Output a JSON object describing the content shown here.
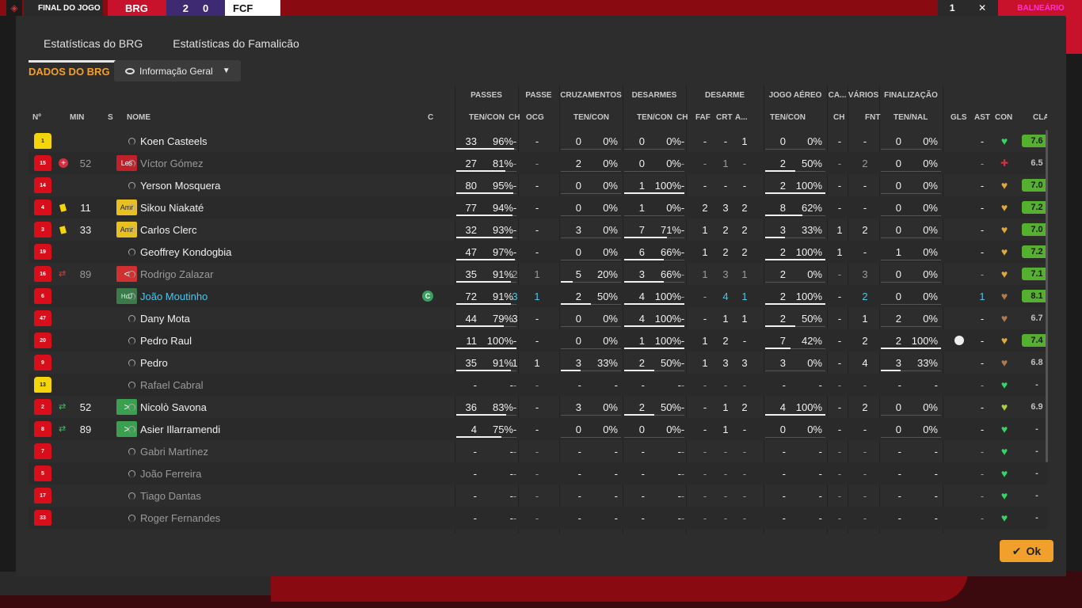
{
  "scorebar": {
    "final_label": "FINAL DO JOGO",
    "team1": "BRG",
    "score1": "2",
    "score2": "0",
    "team2": "FCF",
    "ctrl": "1",
    "balneario": "BALNEÁRIO"
  },
  "tabs": [
    {
      "label": "Estatísticas do BRG",
      "active": true
    },
    {
      "label": "Estatísticas do Famalicão",
      "active": false
    }
  ],
  "section_title": "DADOS DO BRG",
  "view_dropdown": "Informação Geral",
  "groups": {
    "passes": "PASSES",
    "passe": "PASSE",
    "cruzamentos": "CRUZAMENTOS",
    "desarmes": "DESARMES",
    "desarme": "DESARME",
    "jogo_aereo": "JOGO AÉREO",
    "ca": "CA...",
    "varios": "VÁRIOS",
    "finalizacao": "FINALIZAÇÃO"
  },
  "headers": {
    "num": "Nº",
    "min": "MIN",
    "s": "S",
    "nome": "NOME",
    "c": "C",
    "passes": "TEN/CON",
    "passe_ch": "CH",
    "passe_ocg": "OCG",
    "cruz": "TEN/CON",
    "desarmes": "TEN/CON",
    "des_ch": "CH",
    "des_faf": "FAF",
    "des_crt": "CRT",
    "des_a": "A...",
    "aereo": "TEN/CON",
    "ca_ch": "CH",
    "fnt": "FNT",
    "fin": "TEN/NAL",
    "gls": "GLS",
    "ast": "AST",
    "con": "CON",
    "cla": "CLA"
  },
  "rows": [
    {
      "n": "1",
      "gk": true,
      "min": "",
      "ic": "",
      "st": "",
      "stc": "",
      "name": "Koen Casteels",
      "hl": false,
      "dim": false,
      "pass": [
        "33",
        "96%"
      ],
      "pw": 0.96,
      "pch": "-",
      "pocg": "-",
      "cr": [
        "0",
        "0%"
      ],
      "cw": 0,
      "de": [
        "0",
        "0%"
      ],
      "dw": 0,
      "dch": "-",
      "faf": "-",
      "crt": "-",
      "da": "1",
      "ae": [
        "0",
        "0%"
      ],
      "aw": 0,
      "cach": "-",
      "fnt": "-",
      "fi": [
        "0",
        "0%"
      ],
      "fw": 0,
      "gls": "",
      "ast": "-",
      "con": "g",
      "cla": "7.6",
      "clag": true
    },
    {
      "n": "15",
      "gk": false,
      "min": "52",
      "ic": "inj",
      "st": "Les",
      "stc": "les",
      "name": "Víctor Gómez",
      "hl": false,
      "dim": true,
      "pass": [
        "27",
        "81%"
      ],
      "pw": 0.81,
      "pch": "-",
      "pocg": "-",
      "cr": [
        "2",
        "0%"
      ],
      "cw": 0,
      "de": [
        "0",
        "0%"
      ],
      "dw": 0,
      "dch": "-",
      "faf": "-",
      "crt": "1",
      "da": "-",
      "ae": [
        "2",
        "50%"
      ],
      "aw": 0.5,
      "cach": "-",
      "fnt": "2",
      "fi": [
        "0",
        "0%"
      ],
      "fw": 0,
      "gls": "",
      "ast": "-",
      "con": "x",
      "cla": "6.5",
      "clag": false
    },
    {
      "n": "14",
      "gk": false,
      "min": "",
      "ic": "",
      "st": "",
      "stc": "",
      "name": "Yerson Mosquera",
      "hl": false,
      "dim": false,
      "pass": [
        "80",
        "95%"
      ],
      "pw": 0.95,
      "pch": "-",
      "pocg": "-",
      "cr": [
        "0",
        "0%"
      ],
      "cw": 0,
      "de": [
        "1",
        "100%"
      ],
      "dw": 1,
      "dch": "-",
      "faf": "-",
      "crt": "-",
      "da": "-",
      "ae": [
        "2",
        "100%"
      ],
      "aw": 1,
      "cach": "-",
      "fnt": "-",
      "fi": [
        "0",
        "0%"
      ],
      "fw": 0,
      "gls": "",
      "ast": "-",
      "con": "o",
      "cla": "7.0",
      "clag": true
    },
    {
      "n": "4",
      "gk": false,
      "min": "11",
      "ic": "yc",
      "st": "Amr",
      "stc": "amr",
      "name": "Sikou Niakaté",
      "hl": false,
      "dim": false,
      "pass": [
        "77",
        "94%"
      ],
      "pw": 0.94,
      "pch": "-",
      "pocg": "-",
      "cr": [
        "0",
        "0%"
      ],
      "cw": 0,
      "de": [
        "1",
        "0%"
      ],
      "dw": 0,
      "dch": "-",
      "faf": "2",
      "crt": "3",
      "da": "2",
      "ae": [
        "8",
        "62%"
      ],
      "aw": 0.62,
      "cach": "-",
      "fnt": "-",
      "fi": [
        "0",
        "0%"
      ],
      "fw": 0,
      "gls": "",
      "ast": "-",
      "con": "o",
      "cla": "7.2",
      "clag": true
    },
    {
      "n": "3",
      "gk": false,
      "min": "33",
      "ic": "yc",
      "st": "Amr",
      "stc": "amr",
      "name": "Carlos Clerc",
      "hl": false,
      "dim": false,
      "pass": [
        "32",
        "93%"
      ],
      "pw": 0.93,
      "pch": "-",
      "pocg": "-",
      "cr": [
        "3",
        "0%"
      ],
      "cw": 0,
      "de": [
        "7",
        "71%"
      ],
      "dw": 0.71,
      "dch": "-",
      "faf": "1",
      "crt": "2",
      "da": "2",
      "ae": [
        "3",
        "33%"
      ],
      "aw": 0.33,
      "cach": "1",
      "fnt": "2",
      "fi": [
        "0",
        "0%"
      ],
      "fw": 0,
      "gls": "",
      "ast": "-",
      "con": "o",
      "cla": "7.0",
      "clag": true
    },
    {
      "n": "19",
      "gk": false,
      "min": "",
      "ic": "",
      "st": "",
      "stc": "",
      "name": "Geoffrey Kondogbia",
      "hl": false,
      "dim": false,
      "pass": [
        "47",
        "97%"
      ],
      "pw": 0.97,
      "pch": "-",
      "pocg": "-",
      "cr": [
        "0",
        "0%"
      ],
      "cw": 0,
      "de": [
        "6",
        "66%"
      ],
      "dw": 0.66,
      "dch": "-",
      "faf": "1",
      "crt": "2",
      "da": "2",
      "ae": [
        "2",
        "100%"
      ],
      "aw": 1,
      "cach": "1",
      "fnt": "-",
      "fi": [
        "1",
        "0%"
      ],
      "fw": 0,
      "gls": "",
      "ast": "-",
      "con": "o",
      "cla": "7.2",
      "clag": true
    },
    {
      "n": "16",
      "gk": false,
      "min": "89",
      "ic": "subout",
      "st": "<",
      "stc": "out",
      "name": "Rodrigo Zalazar",
      "hl": false,
      "dim": true,
      "pass": [
        "35",
        "91%"
      ],
      "pw": 0.91,
      "pch": "2",
      "pocg": "1",
      "cr": [
        "5",
        "20%"
      ],
      "cw": 0.2,
      "de": [
        "3",
        "66%"
      ],
      "dw": 0.66,
      "dch": "-",
      "faf": "1",
      "crt": "3",
      "da": "1",
      "ae": [
        "2",
        "0%"
      ],
      "aw": 0,
      "cach": "-",
      "fnt": "3",
      "fi": [
        "0",
        "0%"
      ],
      "fw": 0,
      "gls": "",
      "ast": "-",
      "con": "o",
      "cla": "7.1",
      "clag": true
    },
    {
      "n": "6",
      "gk": false,
      "min": "",
      "ic": "",
      "st": "HdJ",
      "stc": "hdj",
      "name": "João Moutinho",
      "hl": true,
      "dim": false,
      "cap": true,
      "pass": [
        "72",
        "91%"
      ],
      "pw": 0.91,
      "pch": "3",
      "pocg": "1",
      "cr": [
        "2",
        "50%"
      ],
      "cw": 0.5,
      "de": [
        "4",
        "100%"
      ],
      "dw": 1,
      "dch": "-",
      "faf": "-",
      "crt": "4",
      "da": "1",
      "ae": [
        "2",
        "100%"
      ],
      "aw": 1,
      "cach": "-",
      "fnt": "2",
      "fi": [
        "0",
        "0%"
      ],
      "fw": 0,
      "gls": "",
      "ast": "1",
      "con": "b",
      "cla": "8.1",
      "clag": true
    },
    {
      "n": "47",
      "gk": false,
      "min": "",
      "ic": "",
      "st": "",
      "stc": "",
      "name": "Dany Mota",
      "hl": false,
      "dim": false,
      "pass": [
        "44",
        "79%"
      ],
      "pw": 0.79,
      "pch": "3",
      "pocg": "-",
      "cr": [
        "0",
        "0%"
      ],
      "cw": 0,
      "de": [
        "4",
        "100%"
      ],
      "dw": 1,
      "dch": "-",
      "faf": "-",
      "crt": "1",
      "da": "1",
      "ae": [
        "2",
        "50%"
      ],
      "aw": 0.5,
      "cach": "-",
      "fnt": "1",
      "fi": [
        "2",
        "0%"
      ],
      "fw": 0,
      "gls": "",
      "ast": "-",
      "con": "b",
      "cla": "6.7",
      "clag": false
    },
    {
      "n": "20",
      "gk": false,
      "min": "",
      "ic": "",
      "st": "",
      "stc": "",
      "name": "Pedro Raul",
      "hl": false,
      "dim": false,
      "pass": [
        "11",
        "100%"
      ],
      "pw": 1,
      "pch": "-",
      "pocg": "-",
      "cr": [
        "0",
        "0%"
      ],
      "cw": 0,
      "de": [
        "1",
        "100%"
      ],
      "dw": 1,
      "dch": "-",
      "faf": "1",
      "crt": "2",
      "da": "-",
      "ae": [
        "7",
        "42%"
      ],
      "aw": 0.42,
      "cach": "-",
      "fnt": "2",
      "fi": [
        "2",
        "100%"
      ],
      "fw": 1,
      "gls": "ball",
      "ast": "-",
      "con": "o",
      "cla": "7.4",
      "clag": true
    },
    {
      "n": "9",
      "gk": false,
      "min": "",
      "ic": "",
      "st": "",
      "stc": "",
      "name": "Pedro",
      "hl": false,
      "dim": false,
      "pass": [
        "35",
        "91%"
      ],
      "pw": 0.91,
      "pch": "1",
      "pocg": "1",
      "cr": [
        "3",
        "33%"
      ],
      "cw": 0.33,
      "de": [
        "2",
        "50%"
      ],
      "dw": 0.5,
      "dch": "-",
      "faf": "1",
      "crt": "3",
      "da": "3",
      "ae": [
        "3",
        "0%"
      ],
      "aw": 0,
      "cach": "-",
      "fnt": "4",
      "fi": [
        "3",
        "33%"
      ],
      "fw": 0.33,
      "gls": "",
      "ast": "-",
      "con": "b",
      "cla": "6.8",
      "clag": false
    },
    {
      "n": "13",
      "gk": true,
      "min": "",
      "ic": "",
      "st": "",
      "stc": "",
      "name": "Rafael Cabral",
      "hl": false,
      "dim": true,
      "pass": [
        "-",
        "-"
      ],
      "pw": 0,
      "pch": "-",
      "pocg": "-",
      "cr": [
        "-",
        "-"
      ],
      "cw": 0,
      "de": [
        "-",
        "-"
      ],
      "dw": 0,
      "dch": "-",
      "faf": "-",
      "crt": "-",
      "da": "-",
      "ae": [
        "-",
        "-"
      ],
      "aw": 0,
      "cach": "-",
      "fnt": "-",
      "fi": [
        "-",
        "-"
      ],
      "fw": 0,
      "gls": "",
      "ast": "-",
      "con": "g",
      "cla": "-",
      "clag": false
    },
    {
      "n": "2",
      "gk": false,
      "min": "52",
      "ic": "subin",
      "st": ">",
      "stc": "in",
      "name": "Nicolò Savona",
      "hl": false,
      "dim": false,
      "pass": [
        "36",
        "83%"
      ],
      "pw": 0.83,
      "pch": "-",
      "pocg": "-",
      "cr": [
        "3",
        "0%"
      ],
      "cw": 0,
      "de": [
        "2",
        "50%"
      ],
      "dw": 0.5,
      "dch": "-",
      "faf": "-",
      "crt": "1",
      "da": "2",
      "ae": [
        "4",
        "100%"
      ],
      "aw": 1,
      "cach": "-",
      "fnt": "2",
      "fi": [
        "0",
        "0%"
      ],
      "fw": 0,
      "gls": "",
      "ast": "-",
      "con": "y",
      "cla": "6.9",
      "clag": false
    },
    {
      "n": "8",
      "gk": false,
      "min": "89",
      "ic": "subin",
      "st": ">",
      "stc": "in",
      "name": "Asier Illarramendi",
      "hl": false,
      "dim": false,
      "pass": [
        "4",
        "75%"
      ],
      "pw": 0.75,
      "pch": "-",
      "pocg": "-",
      "cr": [
        "0",
        "0%"
      ],
      "cw": 0,
      "de": [
        "0",
        "0%"
      ],
      "dw": 0,
      "dch": "-",
      "faf": "-",
      "crt": "1",
      "da": "-",
      "ae": [
        "0",
        "0%"
      ],
      "aw": 0,
      "cach": "-",
      "fnt": "-",
      "fi": [
        "0",
        "0%"
      ],
      "fw": 0,
      "gls": "",
      "ast": "-",
      "con": "g",
      "cla": "-",
      "clag": false
    },
    {
      "n": "7",
      "gk": false,
      "min": "",
      "ic": "",
      "st": "",
      "stc": "",
      "name": "Gabri Martínez",
      "hl": false,
      "dim": true,
      "pass": [
        "-",
        "-"
      ],
      "pw": 0,
      "pch": "-",
      "pocg": "-",
      "cr": [
        "-",
        "-"
      ],
      "cw": 0,
      "de": [
        "-",
        "-"
      ],
      "dw": 0,
      "dch": "-",
      "faf": "-",
      "crt": "-",
      "da": "-",
      "ae": [
        "-",
        "-"
      ],
      "aw": 0,
      "cach": "-",
      "fnt": "-",
      "fi": [
        "-",
        "-"
      ],
      "fw": 0,
      "gls": "",
      "ast": "-",
      "con": "g",
      "cla": "-",
      "clag": false
    },
    {
      "n": "5",
      "gk": false,
      "min": "",
      "ic": "",
      "st": "",
      "stc": "",
      "name": "João Ferreira",
      "hl": false,
      "dim": true,
      "pass": [
        "-",
        "-"
      ],
      "pw": 0,
      "pch": "-",
      "pocg": "-",
      "cr": [
        "-",
        "-"
      ],
      "cw": 0,
      "de": [
        "-",
        "-"
      ],
      "dw": 0,
      "dch": "-",
      "faf": "-",
      "crt": "-",
      "da": "-",
      "ae": [
        "-",
        "-"
      ],
      "aw": 0,
      "cach": "-",
      "fnt": "-",
      "fi": [
        "-",
        "-"
      ],
      "fw": 0,
      "gls": "",
      "ast": "-",
      "con": "g",
      "cla": "-",
      "clag": false
    },
    {
      "n": "17",
      "gk": false,
      "min": "",
      "ic": "",
      "st": "",
      "stc": "",
      "name": "Tiago Dantas",
      "hl": false,
      "dim": true,
      "pass": [
        "-",
        "-"
      ],
      "pw": 0,
      "pch": "-",
      "pocg": "-",
      "cr": [
        "-",
        "-"
      ],
      "cw": 0,
      "de": [
        "-",
        "-"
      ],
      "dw": 0,
      "dch": "-",
      "faf": "-",
      "crt": "-",
      "da": "-",
      "ae": [
        "-",
        "-"
      ],
      "aw": 0,
      "cach": "-",
      "fnt": "-",
      "fi": [
        "-",
        "-"
      ],
      "fw": 0,
      "gls": "",
      "ast": "-",
      "con": "g",
      "cla": "-",
      "clag": false
    },
    {
      "n": "33",
      "gk": false,
      "min": "",
      "ic": "",
      "st": "",
      "stc": "",
      "name": "Roger Fernandes",
      "hl": false,
      "dim": true,
      "pass": [
        "-",
        "-"
      ],
      "pw": 0,
      "pch": "-",
      "pocg": "-",
      "cr": [
        "-",
        "-"
      ],
      "cw": 0,
      "de": [
        "-",
        "-"
      ],
      "dw": 0,
      "dch": "-",
      "faf": "-",
      "crt": "-",
      "da": "-",
      "ae": [
        "-",
        "-"
      ],
      "aw": 0,
      "cach": "-",
      "fnt": "-",
      "fi": [
        "-",
        "-"
      ],
      "fw": 0,
      "gls": "",
      "ast": "-",
      "con": "g",
      "cla": "-",
      "clag": false
    }
  ],
  "ok_label": "Ok"
}
